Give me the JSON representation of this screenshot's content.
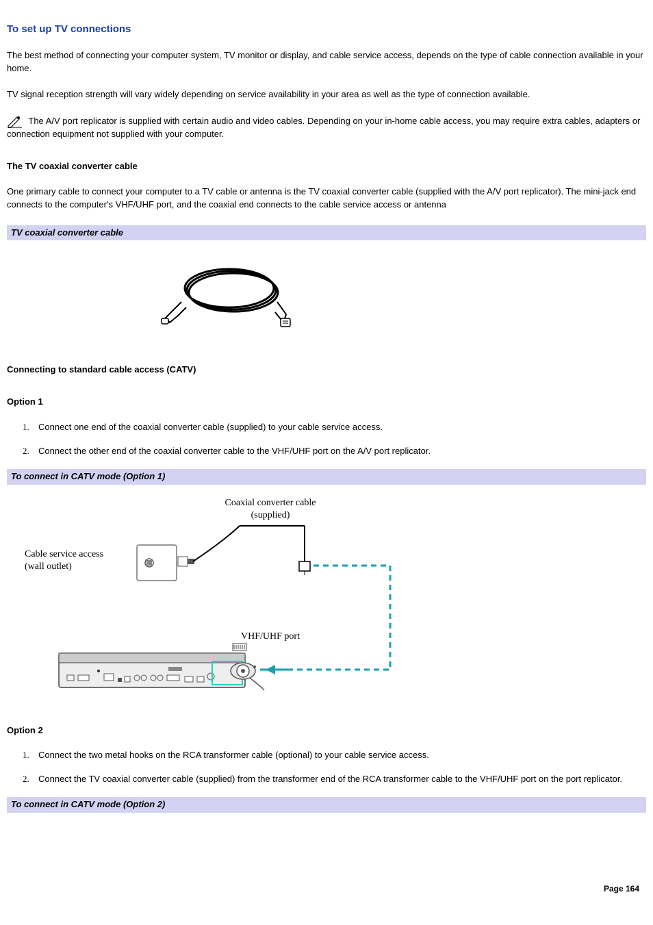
{
  "heading": "To set up TV connections",
  "para1": "The best method of connecting your computer system, TV monitor or display, and cable service access, depends on the type of cable connection available in your home.",
  "para2": "TV signal reception strength will vary widely depending on service availability in your area as well as the type of connection available.",
  "note": "The A/V port replicator is supplied with certain audio and video cables. Depending on your in-home cable access, you may require extra cables, adapters or connection equipment not supplied with your computer.",
  "subhead1": "The TV coaxial converter cable",
  "para3": "One primary cable to connect your computer to a TV cable or antenna is the TV coaxial converter cable (supplied with the A/V port replicator). The mini-jack end connects to the computer's VHF/UHF port, and the coaxial end connects to the cable service access or antenna",
  "caption1": "TV coaxial converter cable",
  "subhead2": "Connecting to standard cable access (CATV)",
  "option1_head": "Option 1",
  "option1_steps": [
    "Connect one end of the coaxial converter cable (supplied) to your cable service access.",
    "Connect the other end of the coaxial converter cable to the VHF/UHF port on the A/V port replicator."
  ],
  "caption2": "To connect in CATV mode (Option 1)",
  "diagram": {
    "label_top": "Coaxial converter cable",
    "label_top2": "(supplied)",
    "label_left": "Cable service access",
    "label_left2": "(wall outlet)",
    "label_port": "VHF/UHF port"
  },
  "option2_head": "Option 2",
  "option2_steps": [
    "Connect the two metal hooks on the RCA transformer cable (optional) to your cable service access.",
    "Connect the TV coaxial converter cable (supplied) from the transformer end of the RCA transformer cable to the VHF/UHF port on the port replicator."
  ],
  "caption3": "To connect in CATV mode (Option 2)",
  "page_label": "Page 164"
}
